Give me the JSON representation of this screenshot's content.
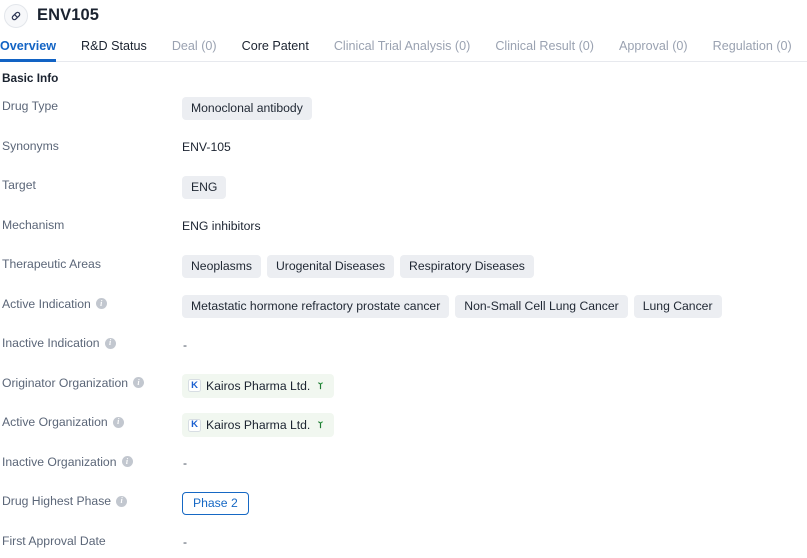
{
  "header": {
    "icon": "pill-capsule-icon",
    "title": "ENV105"
  },
  "tabs": [
    {
      "label": "Overview",
      "active": true,
      "muted": false
    },
    {
      "label": "R&D Status",
      "active": false,
      "muted": false
    },
    {
      "label": "Deal (0)",
      "active": false,
      "muted": true
    },
    {
      "label": "Core Patent",
      "active": false,
      "muted": false
    },
    {
      "label": "Clinical Trial Analysis (0)",
      "active": false,
      "muted": true
    },
    {
      "label": "Clinical Result (0)",
      "active": false,
      "muted": true
    },
    {
      "label": "Approval (0)",
      "active": false,
      "muted": true
    },
    {
      "label": "Regulation (0)",
      "active": false,
      "muted": true
    }
  ],
  "section": {
    "title": "Basic Info"
  },
  "rows": {
    "drug_type": {
      "label": "Drug Type",
      "info": false,
      "values": [
        "Monoclonal antibody"
      ]
    },
    "synonyms": {
      "label": "Synonyms",
      "info": false,
      "text": "ENV-105"
    },
    "target": {
      "label": "Target",
      "info": false,
      "values": [
        "ENG"
      ]
    },
    "mechanism": {
      "label": "Mechanism",
      "info": false,
      "text": "ENG inhibitors"
    },
    "therapeutic_areas": {
      "label": "Therapeutic Areas",
      "info": false,
      "values": [
        "Neoplasms",
        "Urogenital Diseases",
        "Respiratory Diseases"
      ]
    },
    "active_indication": {
      "label": "Active Indication",
      "info": true,
      "values": [
        "Metastatic hormone refractory prostate cancer",
        "Non-Small Cell Lung Cancer",
        "Lung Cancer"
      ]
    },
    "inactive_indication": {
      "label": "Inactive Indication",
      "info": true,
      "text": "-"
    },
    "originator_organization": {
      "label": "Originator Organization",
      "info": true,
      "org": {
        "logo_letter": "K",
        "name": "Kairos Pharma Ltd.",
        "badge_icon": "sprout-icon"
      }
    },
    "active_organization": {
      "label": "Active Organization",
      "info": true,
      "org": {
        "logo_letter": "K",
        "name": "Kairos Pharma Ltd.",
        "badge_icon": "sprout-icon"
      }
    },
    "inactive_organization": {
      "label": "Inactive Organization",
      "info": true,
      "text": "-"
    },
    "drug_highest_phase": {
      "label": "Drug Highest Phase",
      "info": true,
      "badge": "Phase 2"
    },
    "first_approval_date": {
      "label": "First Approval Date",
      "info": false,
      "text": "-"
    }
  },
  "colors": {
    "accent_blue": "#1263c4",
    "chip_bg": "#eceef2",
    "org_chip_bg": "#f1f7f0",
    "sprout_green": "#1f7a33",
    "label_grey": "#5b6678",
    "muted_tab": "#9aa2b1"
  },
  "icons": {
    "info": "i"
  }
}
